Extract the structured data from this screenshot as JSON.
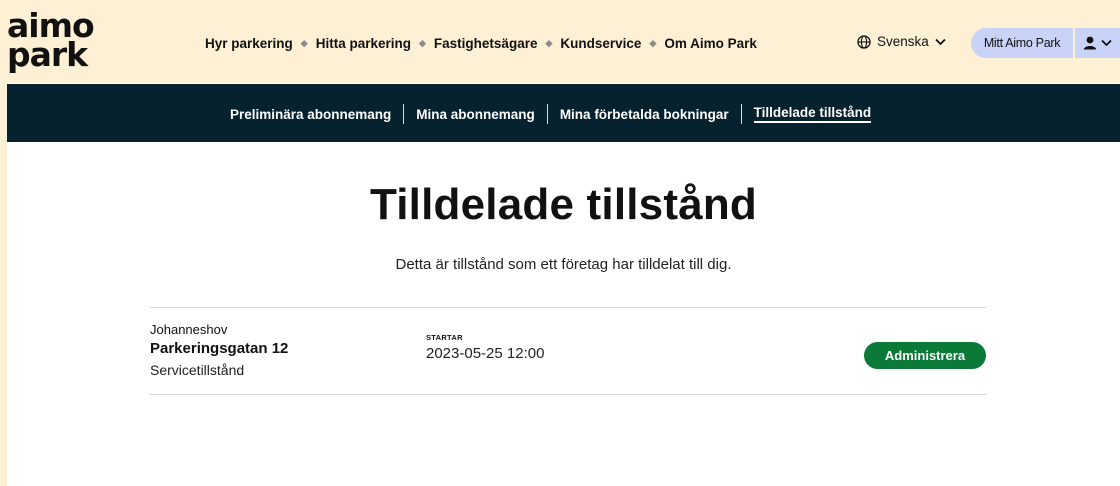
{
  "logo": {
    "line1": "aimo",
    "line2": "park"
  },
  "main_nav": [
    {
      "label": "Hyr parkering"
    },
    {
      "label": "Hitta parkering"
    },
    {
      "label": "Fastighetsägare"
    },
    {
      "label": "Kundservice"
    },
    {
      "label": "Om Aimo Park"
    }
  ],
  "language": {
    "label": "Svenska"
  },
  "account": {
    "label": "Mitt Aimo Park"
  },
  "sub_nav": [
    {
      "label": "Preliminära abonnemang"
    },
    {
      "label": "Mina abonnemang"
    },
    {
      "label": "Mina förbetalda bokningar"
    },
    {
      "label": "Tilldelade tillstånd",
      "active": true
    }
  ],
  "page": {
    "title": "Tilldelade tillstånd",
    "subtitle": "Detta är tillstånd som ett företag har tilldelat till dig."
  },
  "permits": [
    {
      "location": "Johanneshov",
      "street": "Parkeringsgatan 12",
      "type": "Servicetillstånd",
      "starts_label": "STARTAR",
      "starts_value": "2023-05-25 12:00",
      "action_label": "Administrera"
    }
  ],
  "colors": {
    "header_bg": "#fdf0d5",
    "subnav_bg": "#06222f",
    "account_bg": "#c9d3f7",
    "action_bg": "#0b7a38"
  },
  "icons": {
    "language": "globe-icon",
    "language_dropdown": "chevron-down-icon",
    "user": "user-icon",
    "user_dropdown": "chevron-down-icon"
  }
}
